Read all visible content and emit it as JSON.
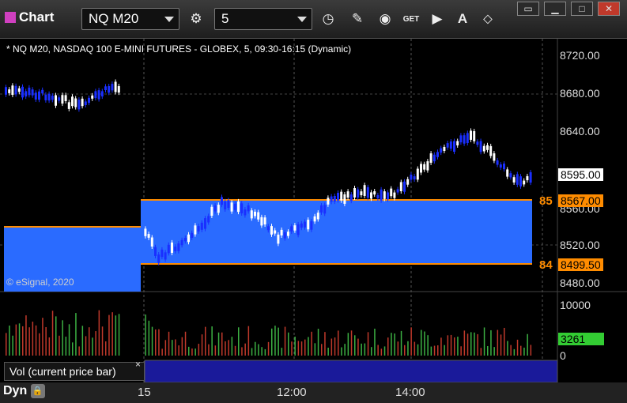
{
  "app": {
    "title": "Chart"
  },
  "toolbar": {
    "symbol": "NQ M20",
    "interval": "5",
    "get_label": "GET",
    "draw_a": "A"
  },
  "chart": {
    "header": "* NQ M20, NASDAQ 100 E-MINI FUTURES - GLOBEX, 5, 09:30-16:15 (Dynamic)",
    "copyright": "© eSignal, 2020",
    "price_axis": [
      "8720.00",
      "8680.00",
      "8640.00",
      "8520.00",
      "8480.00",
      "8560.00"
    ],
    "last_price": "8595.00",
    "upper_level": {
      "value": "8567.00",
      "tag": "85"
    },
    "lower_level": {
      "value": "8499.50",
      "tag": "84"
    },
    "volume_axis": [
      "10000",
      "0"
    ],
    "volume_last": "3261",
    "volume_legend": "Vol (current price bar)",
    "close_glyph": "×",
    "time_axis": [
      "15",
      "12:00",
      "14:00"
    ],
    "mode": "Dyn"
  },
  "colors": {
    "zone": "#2a6bff",
    "level_line": "#ff8c00",
    "up_candle": "#ffffff",
    "down_candle": "#1a2fff",
    "vol_up": "#3cb043",
    "vol_down": "#c0392b",
    "vol_badge": "#33cc33"
  }
}
